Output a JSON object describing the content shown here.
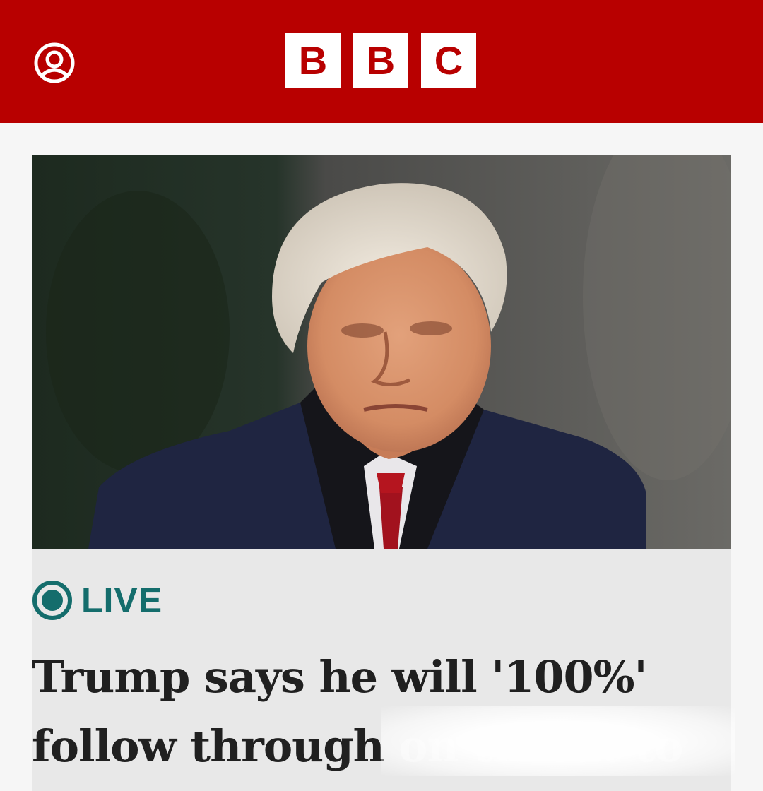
{
  "header": {
    "background_color": "#b80000",
    "account_icon": "account-icon",
    "logo_letters": [
      "B",
      "B",
      "C"
    ]
  },
  "article": {
    "image_alt": "Donald Trump wearing a dark coat, scarf and red tie, looking to the side",
    "live_icon": "live-indicator-icon",
    "live_label": "LIVE",
    "live_color": "#146d6c",
    "headline_line1": "Trump says he will '100%'",
    "headline_line2": "follow through",
    "headline_line2_obscured": "on threat to"
  }
}
